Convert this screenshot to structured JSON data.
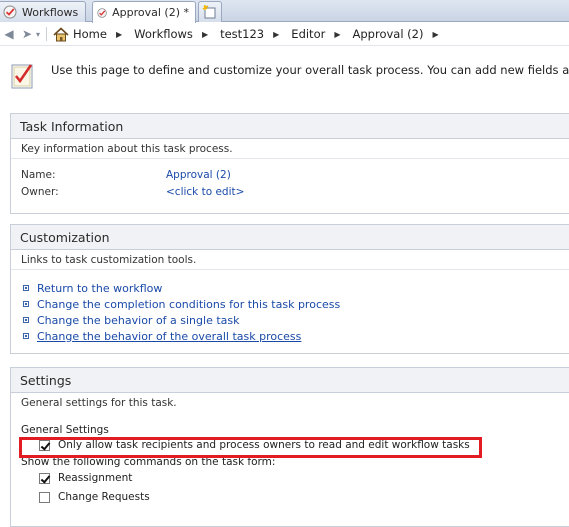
{
  "tabs": [
    {
      "label": "Workflows"
    },
    {
      "label": "Approval (2) *"
    }
  ],
  "breadcrumb": [
    "Home",
    "Workflows",
    "test123",
    "Editor",
    "Approval (2)"
  ],
  "intro": {
    "text": "Use this page to define and customize your overall task process. You can add new fields and outcomes"
  },
  "task_info": {
    "title": "Task Information",
    "description": "Key information about this task process.",
    "name_label": "Name:",
    "name_value": "Approval (2)",
    "owner_label": "Owner:",
    "owner_value": "<click to edit>"
  },
  "customization": {
    "title": "Customization",
    "description": "Links to task customization tools.",
    "links": [
      "Return to the workflow",
      "Change the completion conditions for this task process",
      "Change the behavior of a single task",
      "Change the behavior of the overall task process"
    ]
  },
  "settings": {
    "title": "Settings",
    "description": "General settings for this task.",
    "general_heading": "General Settings",
    "restrict_label": "Only allow task recipients and process owners to read and edit workflow tasks",
    "restrict_checked": true,
    "commands_heading": "Show the following commands on the task form:",
    "reassignment_label": "Reassignment",
    "reassignment_checked": true,
    "change_requests_label": "Change Requests",
    "change_requests_checked": false
  },
  "colors": {
    "link": "#1a4aa8",
    "highlight": "#e31c23",
    "section_header": "#f0f2f5"
  }
}
